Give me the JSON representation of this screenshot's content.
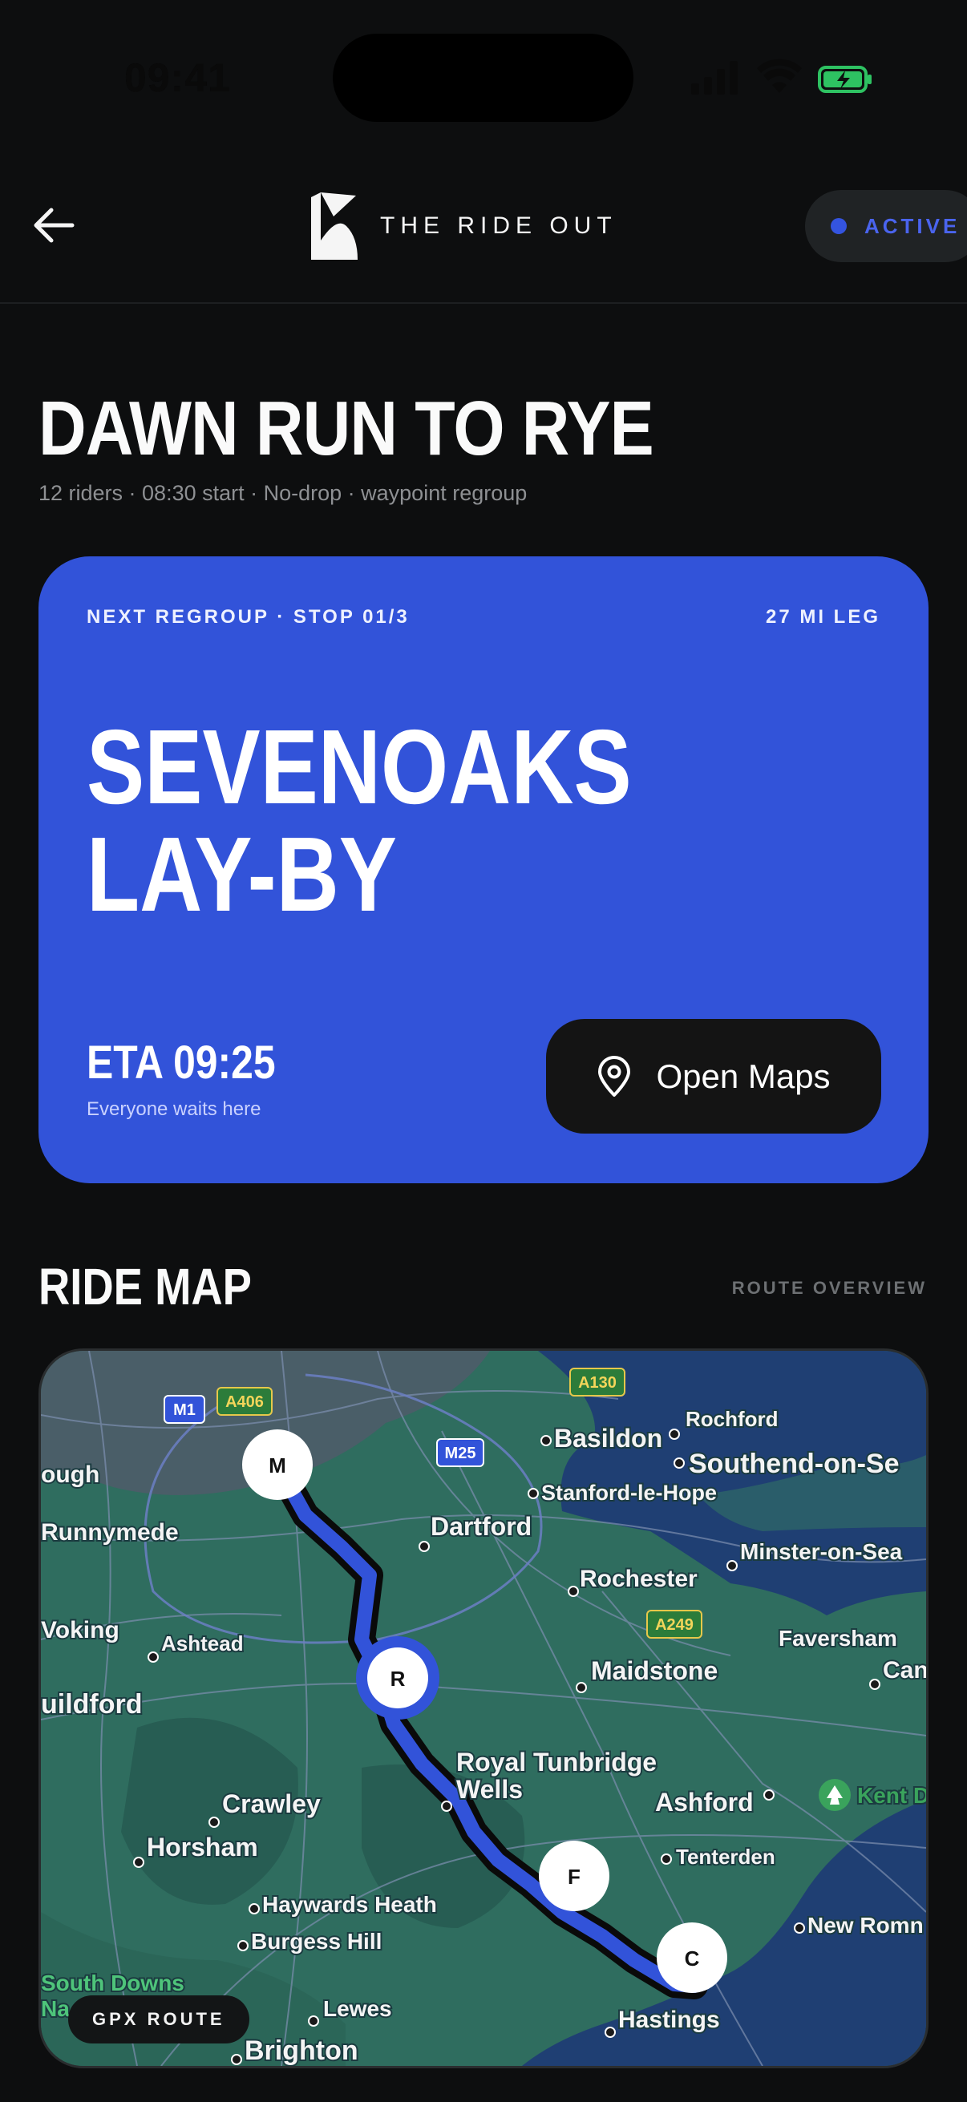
{
  "status_bar": {
    "time": "09:41"
  },
  "header": {
    "brand": "THE RIDE OUT",
    "status_pill": "ACTIVE",
    "colors": {
      "accent": "#3253d9",
      "pill_bg": "#202325"
    }
  },
  "ride": {
    "title": "DAWN RUN TO RYE",
    "subtitle": "12 riders · 08:30 start · No-drop · waypoint regroup"
  },
  "regroup_card": {
    "kicker": "NEXT REGROUP · STOP 01/3",
    "leg": "27 MI LEG",
    "stop_line1": "SEVENOAKS",
    "stop_line2": "LAY-BY",
    "eta": "ETA 09:25",
    "eta_note": "Everyone waits here",
    "button_label": "Open Maps",
    "button_icon": "map-pin-icon"
  },
  "map_section": {
    "title": "RIDE MAP",
    "kicker": "ROUTE OVERVIEW",
    "badge": "GPX ROUTE",
    "markers": [
      "M",
      "R",
      "F",
      "C"
    ],
    "roads": [
      "M1",
      "A406",
      "A130",
      "M25",
      "A249"
    ],
    "places": [
      "Basildon",
      "Rochford",
      "Southend-on-Se",
      "ough",
      "Stanford-le-Hope",
      "Runnymede",
      "Dartford",
      "Minster-on-Sea",
      "Rochester",
      "Voking",
      "Ashtead",
      "Faversham",
      "Can",
      "Maidstone",
      "uildford",
      "Royal Tunbridge",
      "Wells",
      "Kent D",
      "Crawley",
      "Ashford",
      "Horsham",
      "Tenterden",
      "Haywards Heath",
      "New Romn",
      "Burgess Hill",
      "South Downs",
      "Na",
      "Lewes",
      "Hastings",
      "Brighton"
    ]
  }
}
